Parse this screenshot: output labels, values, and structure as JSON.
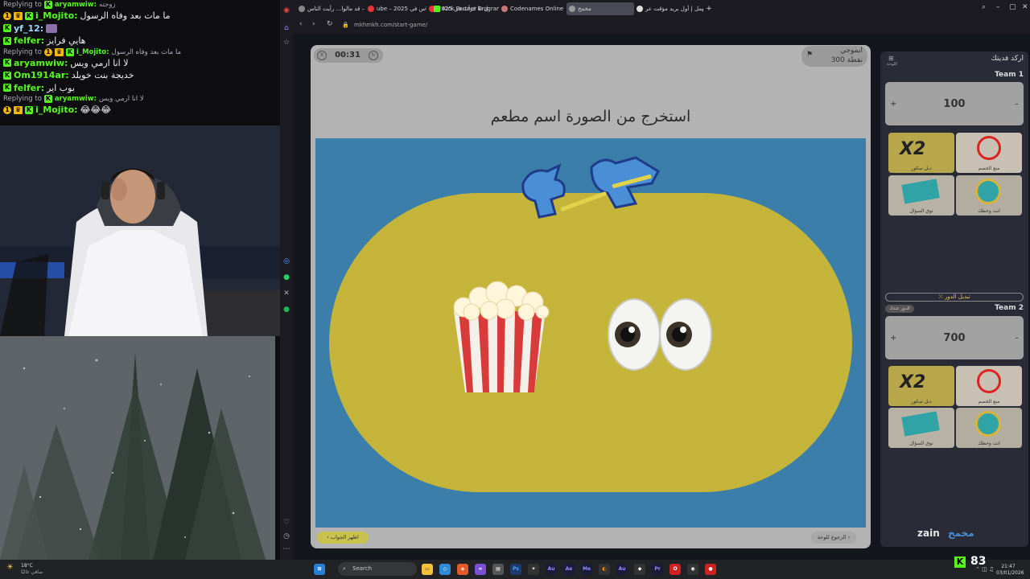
{
  "chat": {
    "messages": [
      {
        "type": "reply",
        "text": "Replying to",
        "user": "aryamwiw:",
        "msg": "زوجته"
      },
      {
        "type": "msg",
        "user": "i_Mojito:",
        "msg": "ما مات بعد وفاه الرسول",
        "style": "gold"
      },
      {
        "type": "msg",
        "user": "yf_12:",
        "msg": "",
        "style": "u2"
      },
      {
        "type": "msg",
        "user": "felfer:",
        "msg": "هايي فرايز",
        "style": "green"
      },
      {
        "type": "reply",
        "text": "Replying to",
        "user": "i_Mojito:",
        "msg": "ما مات بعد وفاه الرسول"
      },
      {
        "type": "msg",
        "user": "aryamwiw:",
        "msg": "لا انا ارمي ويس",
        "style": "green"
      },
      {
        "type": "msg",
        "user": "Om1914ar:",
        "msg": "خديجة بنت خويلد",
        "style": "green"
      },
      {
        "type": "msg",
        "user": "felfer:",
        "msg": "بوب اير",
        "style": "green"
      },
      {
        "type": "reply",
        "text": "Replying to",
        "user": "aryamwiw:",
        "msg": "لا انا ارمي ويس"
      },
      {
        "type": "msg",
        "user": "i_Mojito:",
        "msg": "😂😂😂",
        "style": "gold"
      }
    ]
  },
  "browser": {
    "tabs": [
      {
        "label": "يحبت – قد مالوا… رأيت الناس"
      },
      {
        "label": "ube – 2025 رأيت الناس في"
      },
      {
        "label": "كل ما قرأت في 2025"
      },
      {
        "label": "Kick Partner Program – K"
      },
      {
        "label": "Codenames Online"
      },
      {
        "label": "مخمخ"
      },
      {
        "label": "مهمل | أول بريد مؤقت عر"
      }
    ],
    "url": "mkhmkh.com/start-game/"
  },
  "game": {
    "timer": "00:31",
    "category": "ايموجي",
    "points": "300 نقطة",
    "question": "استخرج من الصورة اسم مطعم",
    "answer_button": "اظهر الجواب",
    "back_button": "الرجوع للوحة",
    "logo_text": "مخمخ"
  },
  "scoreboard": {
    "title": "اركد فديتك",
    "board_label": "اللوحة",
    "team1": {
      "name": "Team 1",
      "score": "100",
      "powerups": [
        "دبل سكور",
        "منع الخصم",
        "نوق السؤال",
        "انت وحظك"
      ]
    },
    "switch_label": "⤫ تبديل الدور",
    "turn_badge": "الدور عندك",
    "team2": {
      "name": "Team 2",
      "score": "700",
      "powerups": [
        "دبل سكور",
        "منع الخصم",
        "نوق السؤال",
        "انت وحظك"
      ]
    },
    "brand": "zain",
    "brand_logo": "مخمخ"
  },
  "taskbar": {
    "weather_temp": "18°C",
    "weather_desc": "صافي غالبًا",
    "search_placeholder": "Search",
    "viewers": "83",
    "time": "21:47",
    "date": "03/01/2026"
  }
}
